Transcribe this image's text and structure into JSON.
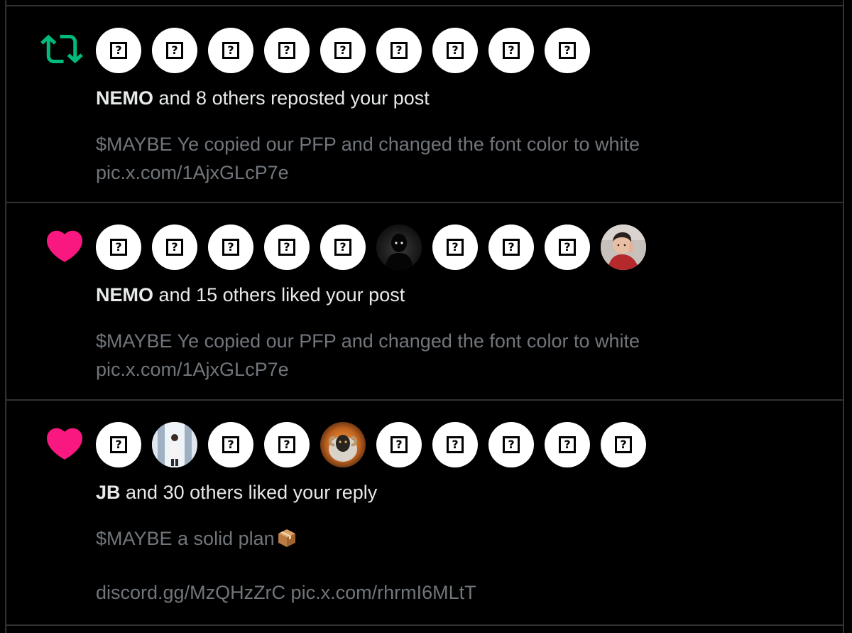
{
  "notifications": [
    {
      "type": "repost",
      "icon": "repost-icon",
      "icon_color": "#00ba7c",
      "avatars": [
        "unknown",
        "unknown",
        "unknown",
        "unknown",
        "unknown",
        "unknown",
        "unknown",
        "unknown",
        "unknown"
      ],
      "actor": "NEMO",
      "action": " and 8 others reposted your post",
      "preview_line1": "$MAYBE Ye copied our PFP and changed the font color to white",
      "preview_line2": "pic.x.com/1AjxGLcP7e"
    },
    {
      "type": "like",
      "icon": "heart-icon",
      "icon_color": "#f91880",
      "avatars": [
        "unknown",
        "unknown",
        "unknown",
        "unknown",
        "unknown",
        "dark-figure",
        "unknown",
        "unknown",
        "unknown",
        "child-photo"
      ],
      "actor": "NEMO",
      "action": " and 15 others liked your post",
      "preview_line1": "$MAYBE Ye copied our PFP and changed the font color to white",
      "preview_line2": "pic.x.com/1AjxGLcP7e"
    },
    {
      "type": "like",
      "icon": "heart-icon",
      "icon_color": "#f91880",
      "avatars": [
        "unknown",
        "person-photo",
        "unknown",
        "unknown",
        "sheep-photo",
        "unknown",
        "unknown",
        "unknown",
        "unknown",
        "unknown"
      ],
      "actor": "JB",
      "action": " and 30 others liked your reply",
      "preview_line1": "$MAYBE a solid plan",
      "preview_emoji": "package-emoji",
      "preview_line2": "discord.gg/MzQHzZrC pic.x.com/rhrmI6MLtT"
    }
  ],
  "colors": {
    "background": "#000000",
    "divider": "#2f3336",
    "primary_text": "#e7e9ea",
    "secondary_text": "#71767b",
    "repost_green": "#00ba7c",
    "like_pink": "#f91880"
  }
}
